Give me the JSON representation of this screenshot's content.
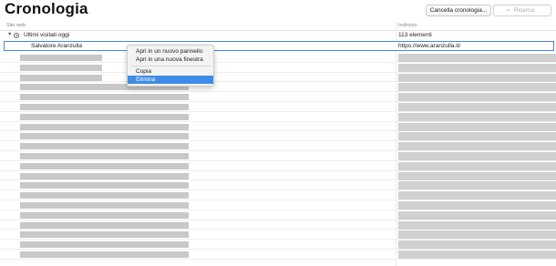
{
  "page": {
    "title": "Cronologia",
    "clear_button": "Cancella cronologia...",
    "search_placeholder": "Ricerca"
  },
  "columns": {
    "site": "Sito web",
    "address": "Indirizzo"
  },
  "group": {
    "label": "Ultimi visitati oggi",
    "count": "113 elementi"
  },
  "selected_row": {
    "site": "Salvatore Aranzulla",
    "url": "https://www.aranzulla.it/"
  },
  "context_menu": {
    "items": [
      "Apri in un nuovo pannello",
      "Apri in una nuova finestra",
      "Copia",
      "Elimina"
    ],
    "highlighted": "Elimina"
  },
  "icons": {
    "disclosure": "disclosure-triangle-icon",
    "clock": "clock-icon",
    "search": "search-icon"
  },
  "colors": {
    "selection": "#3d8ae8",
    "menu_highlight": "#3f8ce6",
    "blur": "#c8c8c8"
  }
}
